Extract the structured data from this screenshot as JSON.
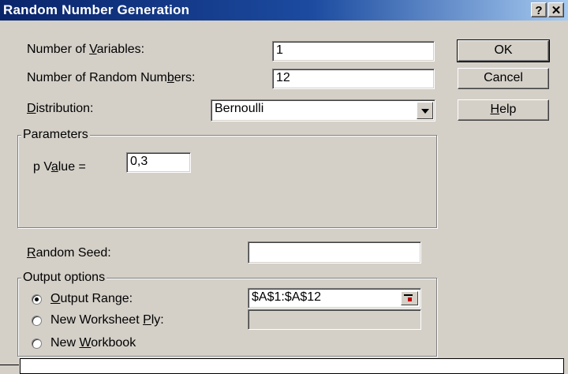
{
  "window": {
    "title": "Random Number Generation",
    "help_glyph": "?",
    "close_glyph": "✕"
  },
  "fields": {
    "num_variables": {
      "label_pre": "Number of ",
      "label_key": "V",
      "label_post": "ariables:",
      "value": "1"
    },
    "num_random": {
      "label_pre": "Number of Random Num",
      "label_key": "b",
      "label_post": "ers:",
      "value": "12"
    },
    "distribution": {
      "label_pre": "",
      "label_key": "D",
      "label_post": "istribution:",
      "value": "Bernoulli"
    }
  },
  "buttons": {
    "ok": "OK",
    "cancel": "Cancel",
    "help_key": "H",
    "help_rest": "elp"
  },
  "parameters": {
    "group_title": "Parameters",
    "p_label_pre": "p V",
    "p_label_key": "a",
    "p_label_post": "lue =",
    "p_value": "0,3"
  },
  "seed": {
    "label_key": "R",
    "label_post": "andom Seed:",
    "value": ""
  },
  "output": {
    "group_title": "Output options",
    "output_range": {
      "label_key": "O",
      "label_post": "utput Range:",
      "value": "$A$1:$A$12",
      "selected": true
    },
    "new_worksheet": {
      "label_pre": "New Worksheet ",
      "label_key": "P",
      "label_post": "ly:",
      "selected": false
    },
    "new_workbook": {
      "label_pre": "New ",
      "label_key": "W",
      "label_post": "orkbook",
      "selected": false
    }
  }
}
